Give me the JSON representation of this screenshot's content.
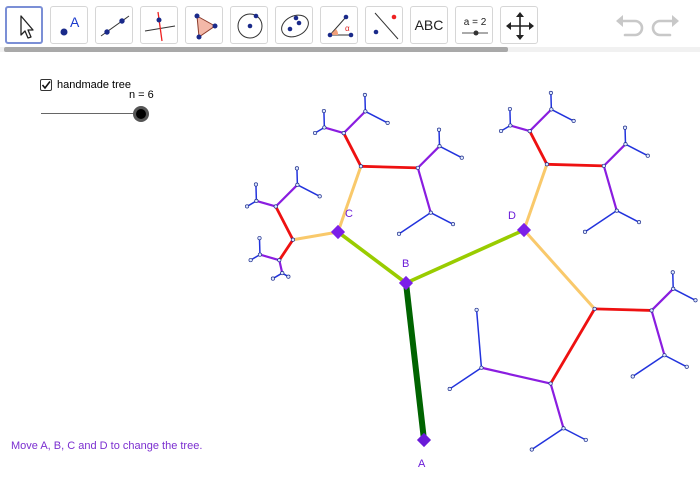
{
  "toolbar": {
    "tools": [
      {
        "name": "move-tool-icon"
      },
      {
        "name": "point-tool-icon",
        "text": "A"
      },
      {
        "name": "line-tool-icon"
      },
      {
        "name": "perpendicular-line-tool-icon"
      },
      {
        "name": "polygon-tool-icon"
      },
      {
        "name": "circle-tool-icon"
      },
      {
        "name": "ellipse-tool-icon"
      },
      {
        "name": "angle-tool-icon",
        "text": "α"
      },
      {
        "name": "reflect-tool-icon"
      },
      {
        "name": "text-tool-icon",
        "text": "ABC"
      },
      {
        "name": "slider-tool-icon",
        "text": "a = 2"
      },
      {
        "name": "move-graphics-view-tool-icon"
      }
    ],
    "undo_icon": "undo-icon",
    "redo_icon": "redo-icon"
  },
  "controls": {
    "checkbox_label": "handmade tree",
    "checkbox_checked": true,
    "slider_label": "n = 6",
    "slider_value": 6
  },
  "points": {
    "A": "A",
    "B": "B",
    "C": "C",
    "D": "D"
  },
  "instruction": "Move A, B, C and D to change the tree.",
  "colors": {
    "level1": "#006400",
    "level2": "#99cc00",
    "level3": "#f9c96b",
    "level4": "#ee1111",
    "level5": "#8a1de0",
    "level6": "#2233dd",
    "point": "#7b1fe8",
    "instruction": "#7b2fd0"
  }
}
